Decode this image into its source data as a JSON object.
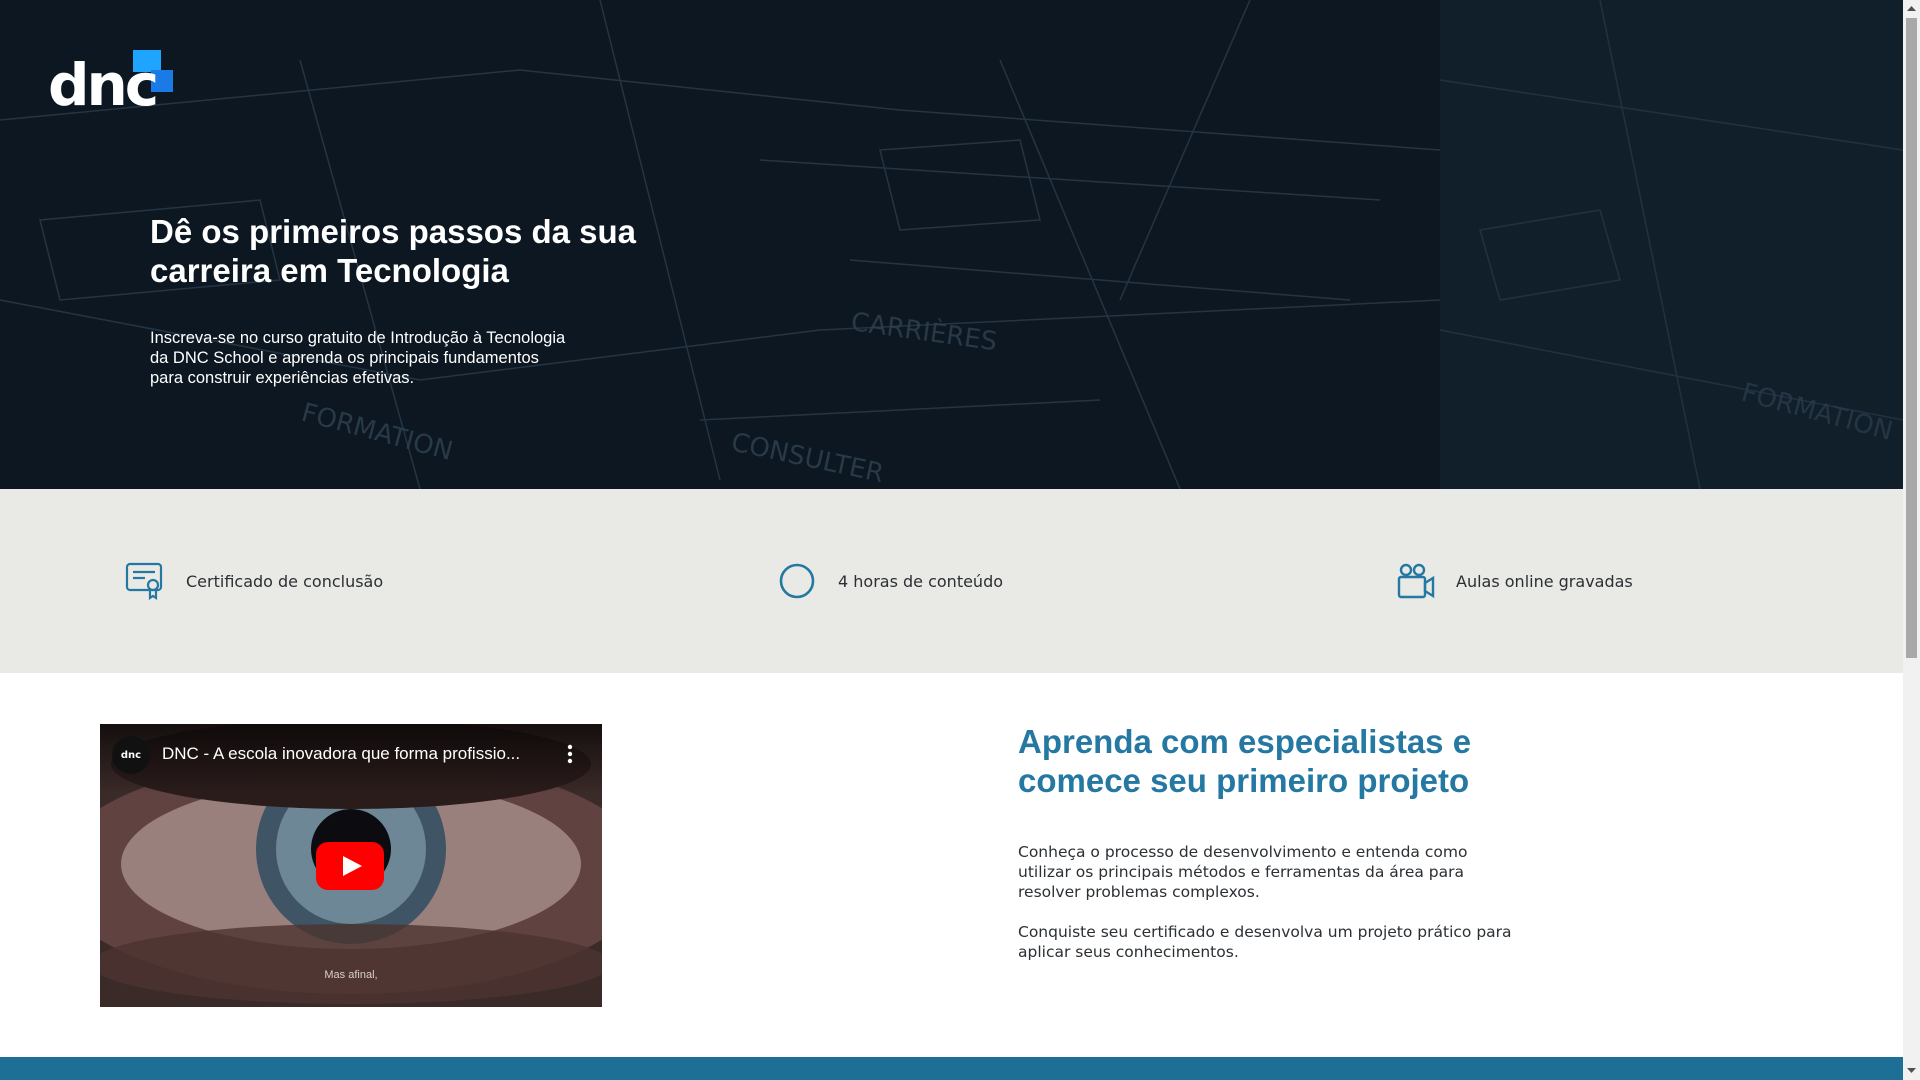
{
  "logo": {
    "text": "dnc"
  },
  "hero": {
    "title": "Dê os primeiros passos da sua carreira em Tecnologia",
    "subtitle": "Inscreva-se no curso gratuito de Introdução à Tecnologia da DNC School e aprenda os principais fundamentos para construir experiências efetivas."
  },
  "features": [
    {
      "label": "Certificado de conclusão",
      "icon": "certificate-icon"
    },
    {
      "label": "4 horas de conteúdo",
      "icon": "clock-icon"
    },
    {
      "label": "Aulas online gravadas",
      "icon": "video-camera-icon"
    }
  ],
  "video": {
    "channel_logo": "dnc",
    "title": "DNC - A escola inovadora que forma profissio...",
    "caption": "Mas afinal,"
  },
  "section": {
    "title": "Aprenda com especialistas e comece seu primeiro projeto",
    "paragraph1": "Conheça o processo de desenvolvimento e entenda como utilizar os principais métodos e ferramentas da área para resolver problemas complexos.",
    "paragraph2": "Conquiste seu certificado e desenvolva um projeto prático para aplicar seus conhecimentos."
  },
  "colors": {
    "accent": "#2478a1",
    "hero_bg": "#0b1620",
    "features_bg": "#e9e9e5",
    "footer_band": "#1e6f96",
    "logo_blue": "#1fa5ff"
  }
}
